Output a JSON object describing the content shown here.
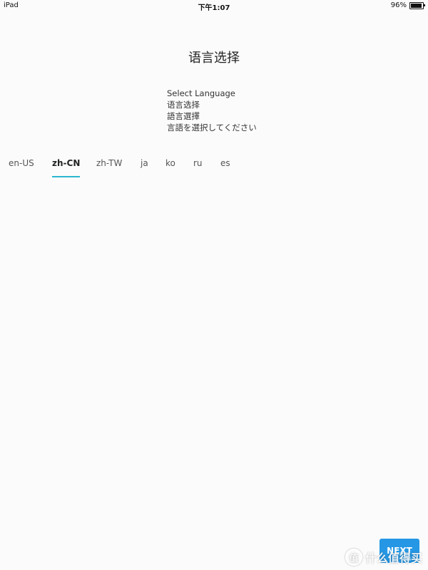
{
  "status_bar": {
    "device": "iPad",
    "time": "下午1:07",
    "battery_percent": "96%",
    "battery_level": 0.96
  },
  "title": "语言选择",
  "prompts": [
    "Select Language",
    "语言选择",
    "語言選擇",
    "言語を選択してください"
  ],
  "languages": {
    "tabs": [
      {
        "code": "en-US",
        "selected": false
      },
      {
        "code": "zh-CN",
        "selected": true
      },
      {
        "code": "zh-TW",
        "selected": false
      },
      {
        "code": "ja",
        "selected": false
      },
      {
        "code": "ko",
        "selected": false
      },
      {
        "code": "ru",
        "selected": false
      },
      {
        "code": "es",
        "selected": false
      }
    ]
  },
  "next_label": "NEXT",
  "watermark": {
    "text": "什么值得买",
    "logo_glyph": "值"
  },
  "colors": {
    "accent_underline": "#2bb6d1",
    "next_button": "#2597e4"
  }
}
